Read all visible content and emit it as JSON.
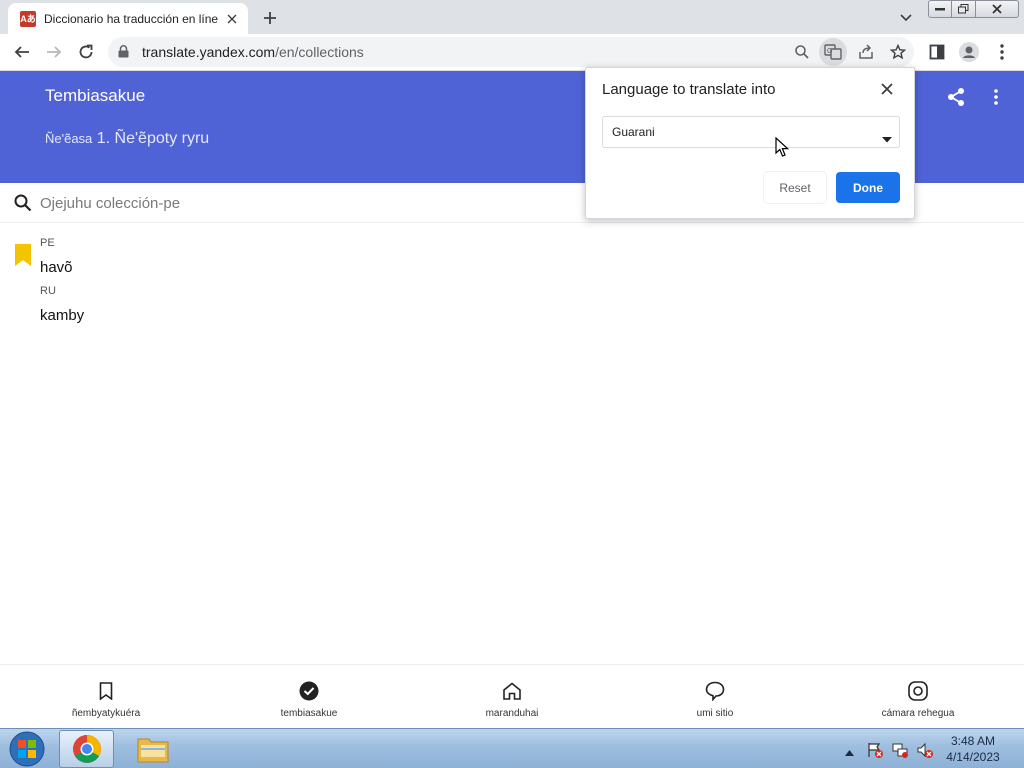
{
  "browser": {
    "tab_title": "Diccionario ha traducción en líne",
    "favicon_text": "Aあ",
    "url_host": "translate.yandex.com",
    "url_path": "/en/collections"
  },
  "page": {
    "title": "Tembiasakue",
    "subtitle_prefix": "Ñe'ẽasa",
    "subtitle_main": "1. Ñe'ẽpoty ryru",
    "search_placeholder": "Ojejuhu colección-pe",
    "entry": {
      "source_lang": "PE",
      "source_word": "havõ",
      "target_lang": "RU",
      "target_word": "kamby"
    }
  },
  "bottom_nav": [
    {
      "label": "ñembyatykuéra",
      "icon": "bookmark-icon"
    },
    {
      "label": "tembiasakue",
      "icon": "check-circle-icon"
    },
    {
      "label": "maranduhai",
      "icon": "home-icon"
    },
    {
      "label": "umi sitio",
      "icon": "chat-bubble-icon"
    },
    {
      "label": "cámara rehegua",
      "icon": "camera-icon"
    }
  ],
  "translate_popup": {
    "title": "Language to translate into",
    "selected_language": "Guarani",
    "reset_label": "Reset",
    "done_label": "Done"
  },
  "taskbar": {
    "time": "3:48 AM",
    "date": "4/14/2023"
  },
  "colors": {
    "header": "#5063d6",
    "done_button": "#1a73e8",
    "bookmark": "#f5c400"
  }
}
